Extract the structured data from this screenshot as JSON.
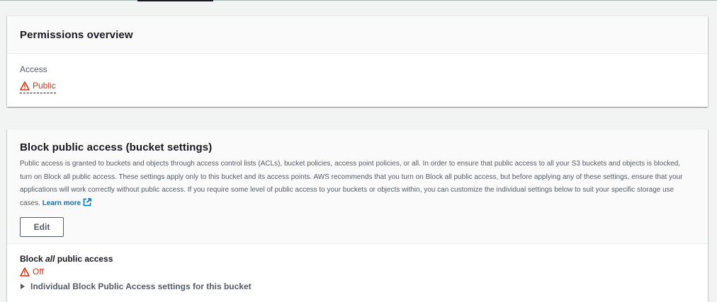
{
  "permissions_overview": {
    "title": "Permissions overview",
    "access_label": "Access",
    "access_value": "Public",
    "status_color": "#d13212"
  },
  "block_public_access": {
    "title": "Block public access (bucket settings)",
    "description": "Public access is granted to buckets and objects through access control lists (ACLs), bucket policies, access point policies, or all. In order to ensure that public access to all your S3 buckets and objects is blocked, turn on Block all public access. These settings apply only to this bucket and its access points. AWS recommends that you turn on Block all public access, but before applying any of these settings, ensure that your applications will work correctly without public access. If you require some level of public access to your buckets or objects within, you can customize the individual settings below to suit your specific storage use cases.",
    "learn_more": "Learn more",
    "edit_label": "Edit",
    "setting_label_prefix": "Block ",
    "setting_label_em": "all",
    "setting_label_suffix": " public access",
    "setting_value": "Off",
    "expander_label": "Individual Block Public Access settings for this bucket",
    "link_color": "#0073bb"
  },
  "icons": {
    "warning": "warning-icon",
    "external_link": "external-link-icon",
    "caret": "caret-right-icon"
  }
}
